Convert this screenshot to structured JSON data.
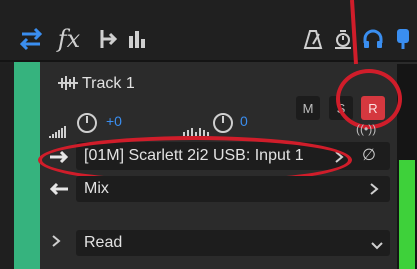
{
  "toolbar": {
    "icons": [
      "routing-icon",
      "effects-icon",
      "sends-icon",
      "eq-icon",
      "metronome-icon",
      "timer-icon",
      "headphones-icon",
      "mic-icon"
    ],
    "fx_label": "fx"
  },
  "track": {
    "name": "Track 1",
    "buttons": {
      "mute": "M",
      "solo": "S",
      "record": "R"
    },
    "volume_value": "+0",
    "pan_value": "0",
    "input_label": "[01M] Scarlett 2i2 USB: Input 1",
    "output_label": "Mix",
    "automation_label": "Read"
  },
  "colors": {
    "track_green": "#36b37e",
    "record_red": "#d5383f",
    "accent_blue": "#3a8ef0",
    "highlight_red": "#d01d2a"
  }
}
